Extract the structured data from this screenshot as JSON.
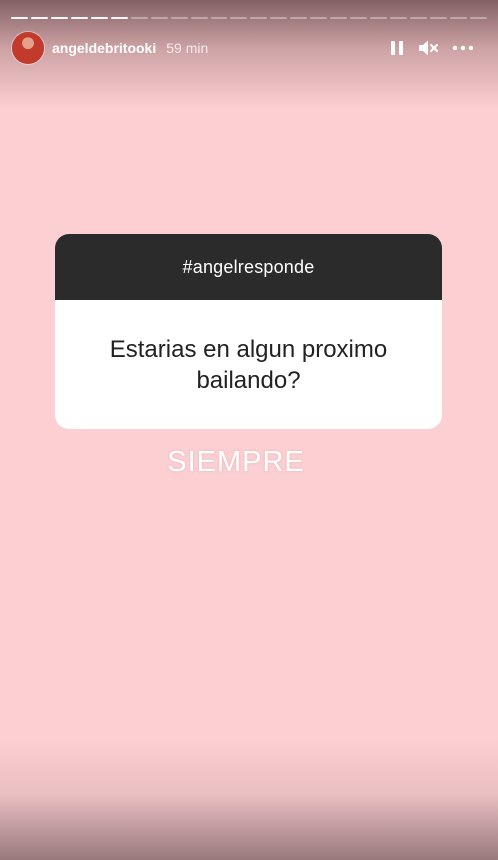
{
  "story": {
    "background_color": "#fccfd2",
    "progress_total_segments": 24,
    "progress_completed_segments": 6
  },
  "header": {
    "username": "angeldebritooki",
    "timestamp": "59 min",
    "avatar_icon": "profile-avatar",
    "controls": [
      "pause-icon",
      "mute-icon",
      "more-icon"
    ]
  },
  "question_card": {
    "tag": "#angelresponde",
    "question": "Estarias en algun proximo bailando?",
    "header_color": "#2b2b2b"
  },
  "answer": {
    "text": "SIEMPRE"
  }
}
